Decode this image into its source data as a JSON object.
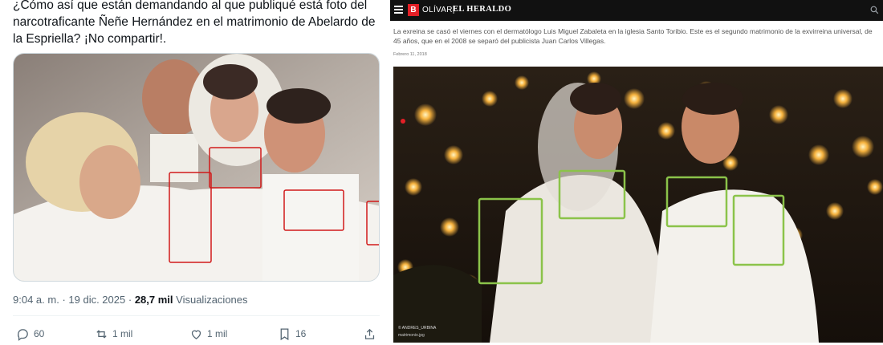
{
  "tweet": {
    "text": "¿Cómo así que están demandando al que publiqué está foto del narcotraficante Ñeñe Hernández en el matrimonio de Abelardo de la Espriella? ¡No compartir!.",
    "time": "9:04 a. m.",
    "date": "19 dic. 2025",
    "views_count": "28,7 mil",
    "views_label": "Visualizaciones",
    "actions": {
      "replies": "60",
      "reposts": "1 mil",
      "likes": "1 mil",
      "bookmarks": "16"
    },
    "accent": "#d11a1a"
  },
  "news": {
    "logo_letter": "B",
    "brand_city": "OLÍVAR|",
    "brand_name": "EL HERALDO",
    "lead": "La exreina se casó el viernes con el dermatólogo Luis Miguel Zabaleta en la iglesia Santo Toribio. Este es el segundo matrimonio de la exvirreina universal, de 45 años, que en el 2008 se separó del publicista Juan Carlos Villegas.",
    "date": "Febrero 11, 2018",
    "photo_credit": "© ANDRES_URBINA",
    "photo_file": "matrimonio.jpg",
    "accent": "#8bc34a",
    "brand_red": "#e41f26"
  },
  "icons": [
    "menu-icon",
    "search-icon",
    "reply-icon",
    "repost-icon",
    "like-icon",
    "bookmark-icon",
    "share-icon"
  ]
}
